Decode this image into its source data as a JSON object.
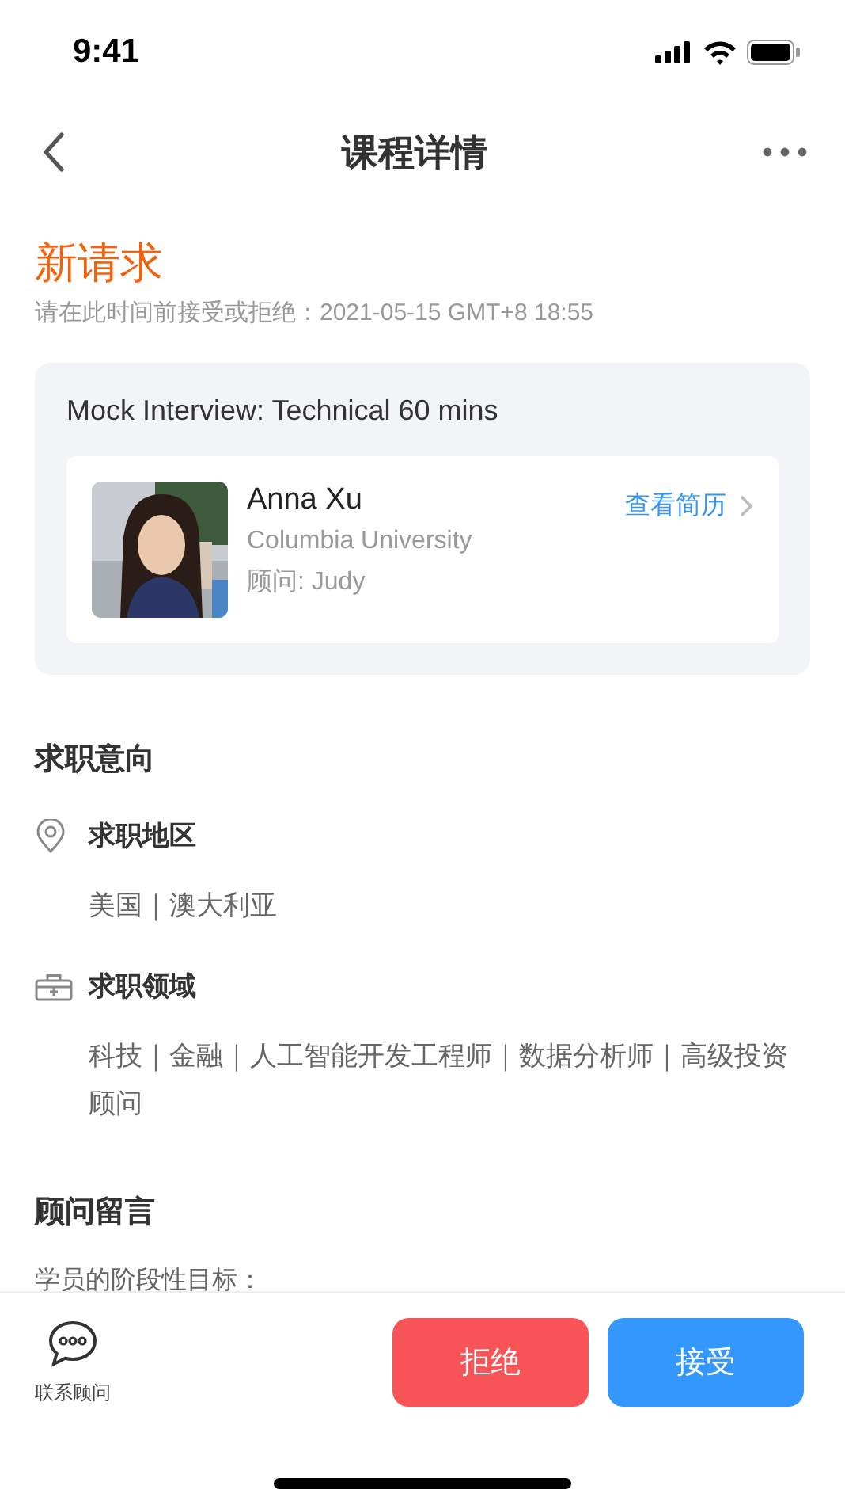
{
  "status_bar": {
    "time": "9:41"
  },
  "nav": {
    "title": "课程详情"
  },
  "request": {
    "title": "新请求",
    "deadline": "请在此时间前接受或拒绝：2021-05-15 GMT+8 18:55"
  },
  "course": {
    "title": "Mock Interview: Technical 60 mins",
    "student": {
      "name": "Anna Xu",
      "school": "Columbia University",
      "advisor": "顾问: Judy",
      "resume_link": "查看简历"
    }
  },
  "intent": {
    "title": "求职意向",
    "items": [
      {
        "kind": "location",
        "label": "求职地区",
        "value": "美国｜澳大利亚"
      },
      {
        "kind": "field",
        "label": "求职领域",
        "value": "科技｜金融｜人工智能开发工程师｜数据分析师｜高级投资顾问"
      }
    ]
  },
  "message": {
    "title": "顾问留言",
    "text": "学员的阶段性目标："
  },
  "bottom_bar": {
    "contact": "联系顾问",
    "buttons": [
      {
        "kind": "reject",
        "label": "拒绝"
      },
      {
        "kind": "accept",
        "label": "接受"
      }
    ]
  }
}
